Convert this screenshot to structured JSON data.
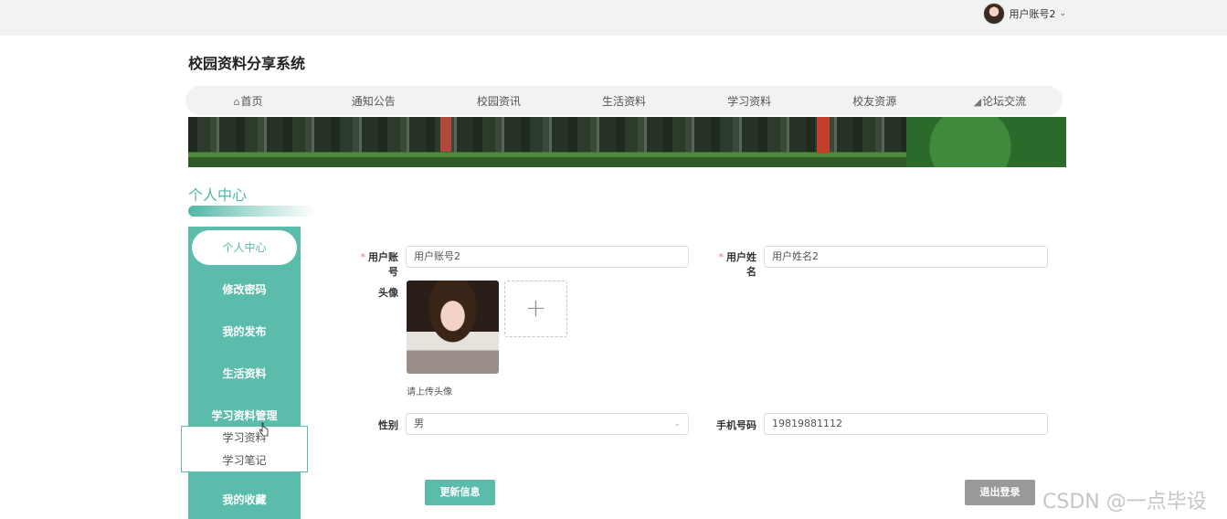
{
  "header": {
    "username": "用户账号2"
  },
  "site_title": "校园资料分享系统",
  "nav": [
    {
      "label": "首页",
      "icon": "home-icon"
    },
    {
      "label": "通知公告"
    },
    {
      "label": "校园资讯"
    },
    {
      "label": "生活资料"
    },
    {
      "label": "学习资料"
    },
    {
      "label": "校友资源"
    },
    {
      "label": "论坛交流",
      "icon": "forum-icon"
    }
  ],
  "section_title": "个人中心",
  "sidebar": {
    "items": [
      "个人中心",
      "修改密码",
      "我的发布",
      "生活资料",
      "学习资料管理",
      "我的收藏"
    ],
    "submenu": [
      "学习资料",
      "学习笔记"
    ]
  },
  "form": {
    "account_label": "用户账号",
    "account_value": "用户账号2",
    "name_label": "用户姓名",
    "name_value": "用户姓名2",
    "avatar_label": "头像",
    "upload_plus": "+",
    "upload_hint": "请上传头像",
    "gender_label": "性别",
    "gender_value": "男",
    "phone_label": "手机号码",
    "phone_value": "19819881112",
    "update_button": "更新信息",
    "logout_button": "退出登录"
  },
  "watermark": "CSDN @一点毕设",
  "colors": {
    "accent": "#5bbcab",
    "topbar": "#f1f2f2",
    "logout": "#999999"
  }
}
